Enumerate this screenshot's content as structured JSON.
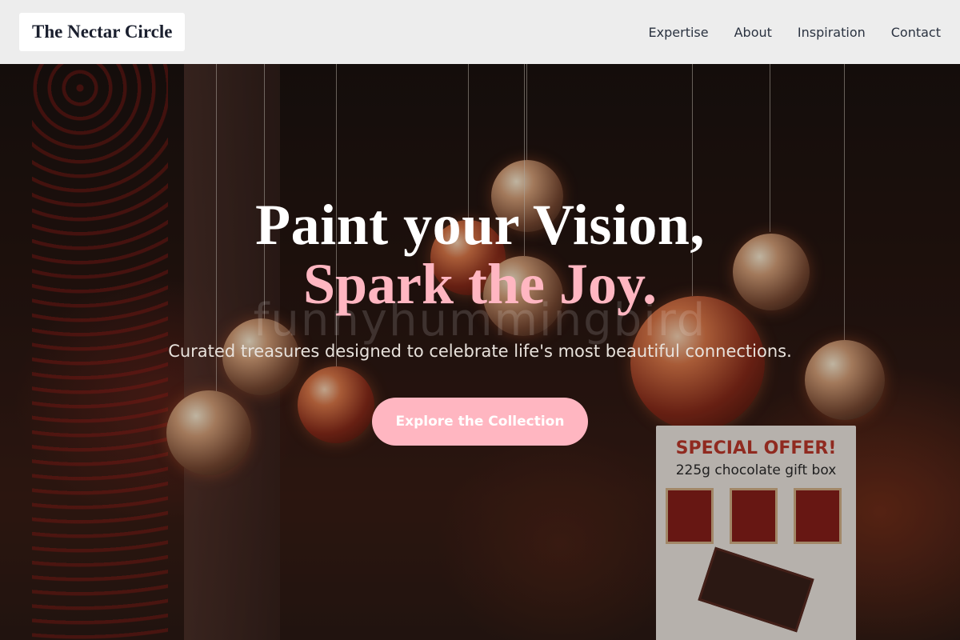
{
  "header": {
    "logo": "The Nectar Circle",
    "nav": [
      "Expertise",
      "About",
      "Inspiration",
      "Contact"
    ]
  },
  "hero": {
    "headline_line1": "Paint your Vision,",
    "headline_line2": "Spark the Joy.",
    "watermark": "funnyhummingbird",
    "subline": "Curated treasures designed to celebrate life's most beautiful connections.",
    "cta_label": "Explore the Collection",
    "sign": {
      "title": "SPECIAL OFFER!",
      "subtitle": "225g chocolate gift box"
    }
  },
  "colors": {
    "accent_pink": "#ffb6c1",
    "header_bg": "#f5f5f5",
    "logo_text": "#1a1f2e"
  }
}
